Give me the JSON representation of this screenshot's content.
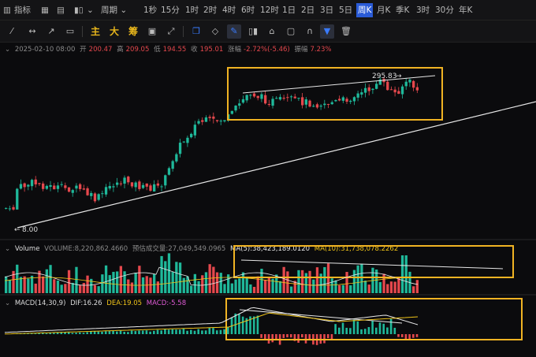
{
  "topbar": {
    "indicator_label": "指标",
    "period_label": "周期",
    "periods": [
      "1秒",
      "15分",
      "1时",
      "2时",
      "4时",
      "6时",
      "12时",
      "1日",
      "2日",
      "3日",
      "5日",
      "周K",
      "月K",
      "季K",
      "3时",
      "30分",
      "年K"
    ],
    "active_period": "周K"
  },
  "toolbar": {
    "main_label": "主",
    "big_label": "大",
    "chip_label": "筹"
  },
  "price_info": {
    "date": "2025-02-10 08:00",
    "open_label": "开",
    "open": "200.47",
    "high_label": "高",
    "high": "209.05",
    "low_label": "低",
    "low": "194.55",
    "close_label": "收",
    "close": "195.01",
    "change_label": "涨幅",
    "change": "-2.72%(-5.46)",
    "amp_label": "振幅",
    "amp": "7.23%"
  },
  "main_chart": {
    "high_marker": "295.83",
    "low_marker": "8.00"
  },
  "volume_panel": {
    "name": "Volume",
    "volume_text": "VOLUME:8,220,862.4660",
    "est_text": "预估成交量:27,049,549.0965",
    "ma5_text": "MA(5):38,423,189.0120",
    "ma10_text": "MA(10):31,738,078.2262"
  },
  "macd_panel": {
    "name": "MACD(14,30,9)",
    "dif_text": "DIF:16.26",
    "dea_text": "DEA:19.05",
    "macd_text": "MACD:-5.58"
  },
  "colors": {
    "up": "#1fb89a",
    "down": "#e5484d",
    "highlight_box": "#f0b323",
    "active": "#2a5bd7"
  }
}
